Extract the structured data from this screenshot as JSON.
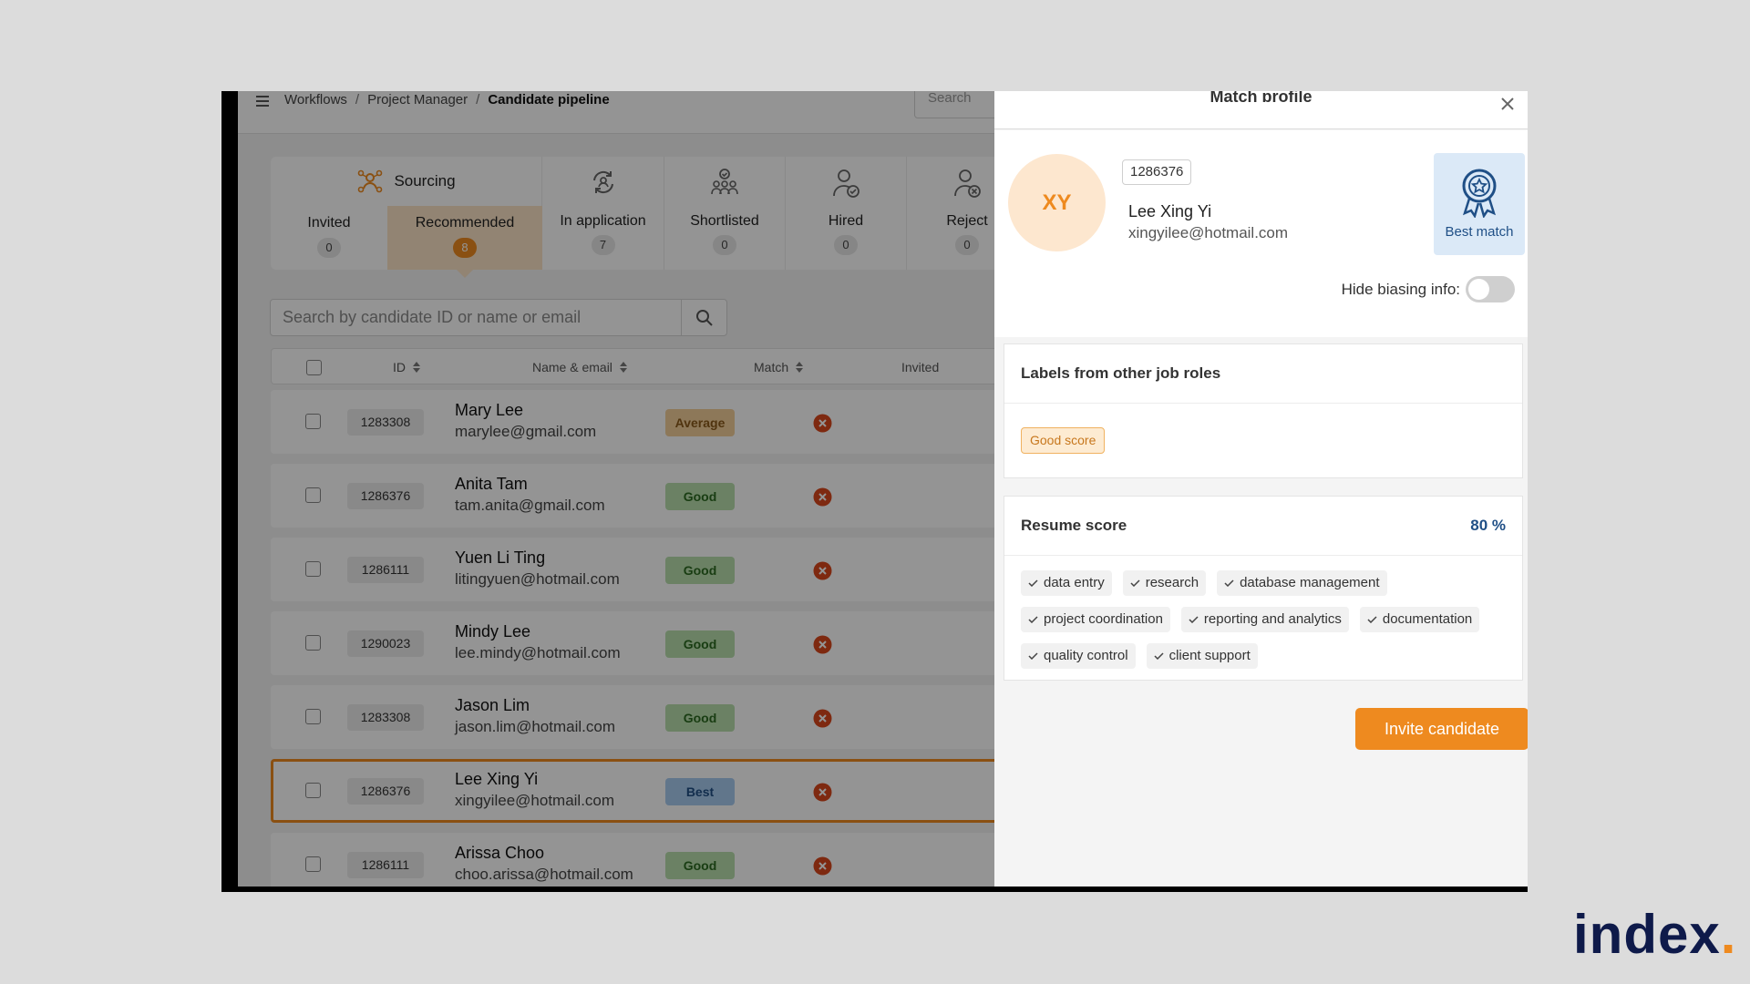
{
  "breadcrumb": [
    "Workflows",
    "Project Manager",
    "Candidate pipeline"
  ],
  "top_search_placeholder": "Search",
  "pipeline": {
    "group_label": "Sourcing",
    "sub_tabs": [
      {
        "label": "Invited",
        "count": "0"
      },
      {
        "label": "Recommended",
        "count": "8"
      }
    ],
    "stages": [
      {
        "label": "In application",
        "count": "7",
        "icon": "refresh-person-icon"
      },
      {
        "label": "Shortlisted",
        "count": "0",
        "icon": "group-check-icon"
      },
      {
        "label": "Hired",
        "count": "0",
        "icon": "person-check-icon"
      },
      {
        "label": "Reject",
        "count": "0",
        "icon": "person-x-icon"
      }
    ]
  },
  "candidate_search_placeholder": "Search by candidate ID or name or email",
  "table": {
    "headers": {
      "id": "ID",
      "name": "Name & email",
      "match": "Match",
      "invited": "Invited"
    },
    "rows": [
      {
        "id": "1283308",
        "name": "Mary Lee",
        "email": "marylee@gmail.com",
        "match": "Average"
      },
      {
        "id": "1286376",
        "name": "Anita Tam",
        "email": "tam.anita@gmail.com",
        "match": "Good"
      },
      {
        "id": "1286111",
        "name": "Yuen Li Ting",
        "email": "litingyuen@hotmail.com",
        "match": "Good"
      },
      {
        "id": "1290023",
        "name": "Mindy Lee",
        "email": "lee.mindy@hotmail.com",
        "match": "Good"
      },
      {
        "id": "1283308",
        "name": "Jason Lim",
        "email": "jason.lim@hotmail.com",
        "match": "Good"
      },
      {
        "id": "1286376",
        "name": "Lee Xing Yi",
        "email": "xingyilee@hotmail.com",
        "match": "Best"
      },
      {
        "id": "1286111",
        "name": "Arissa Choo",
        "email": "choo.arissa@hotmail.com",
        "match": "Good"
      }
    ]
  },
  "drawer": {
    "title": "Match profile",
    "candidate": {
      "initials": "XY",
      "id": "1286376",
      "name": "Lee Xing Yi",
      "email": "xingyilee@hotmail.com"
    },
    "best_match_label": "Best match",
    "hide_biasing_label": "Hide biasing info:",
    "labels_section_title": "Labels from other job roles",
    "labels": [
      "Good score"
    ],
    "resume_title": "Resume score",
    "resume_score": "80 %",
    "skills": [
      "data entry",
      "research",
      "database management",
      "project coordination",
      "reporting and analytics",
      "documentation",
      "quality control",
      "client support"
    ],
    "invite_label": "Invite candidate"
  },
  "brand": {
    "name": "index",
    "dot": ".",
    "accent": "#ee8a1f",
    "navy": "#0e1a4a"
  }
}
